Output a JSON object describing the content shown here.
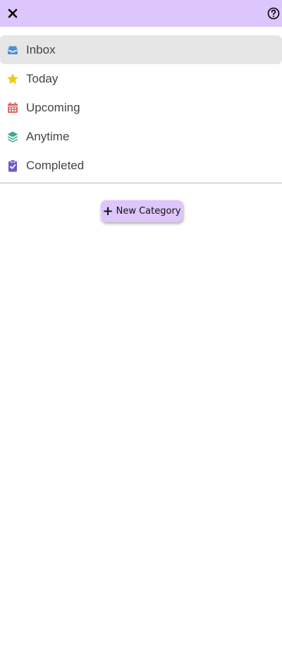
{
  "header": {
    "close_icon": "close-icon",
    "help_icon": "help-icon"
  },
  "nav": {
    "items": [
      {
        "label": "Inbox",
        "icon": "inbox-icon",
        "color": "#4a90d9",
        "active": true
      },
      {
        "label": "Today",
        "icon": "star-icon",
        "color": "#f5c518",
        "active": false
      },
      {
        "label": "Upcoming",
        "icon": "calendar-icon",
        "color": "#e06666",
        "active": false
      },
      {
        "label": "Anytime",
        "icon": "layers-icon",
        "color": "#3fa88f",
        "active": false
      },
      {
        "label": "Completed",
        "icon": "clipboard-check-icon",
        "color": "#6a5acd",
        "active": false
      }
    ]
  },
  "new_category": {
    "label": "New Category"
  },
  "colors": {
    "accent": "#dcc6fb",
    "active_item_bg": "#e6e6e6"
  }
}
